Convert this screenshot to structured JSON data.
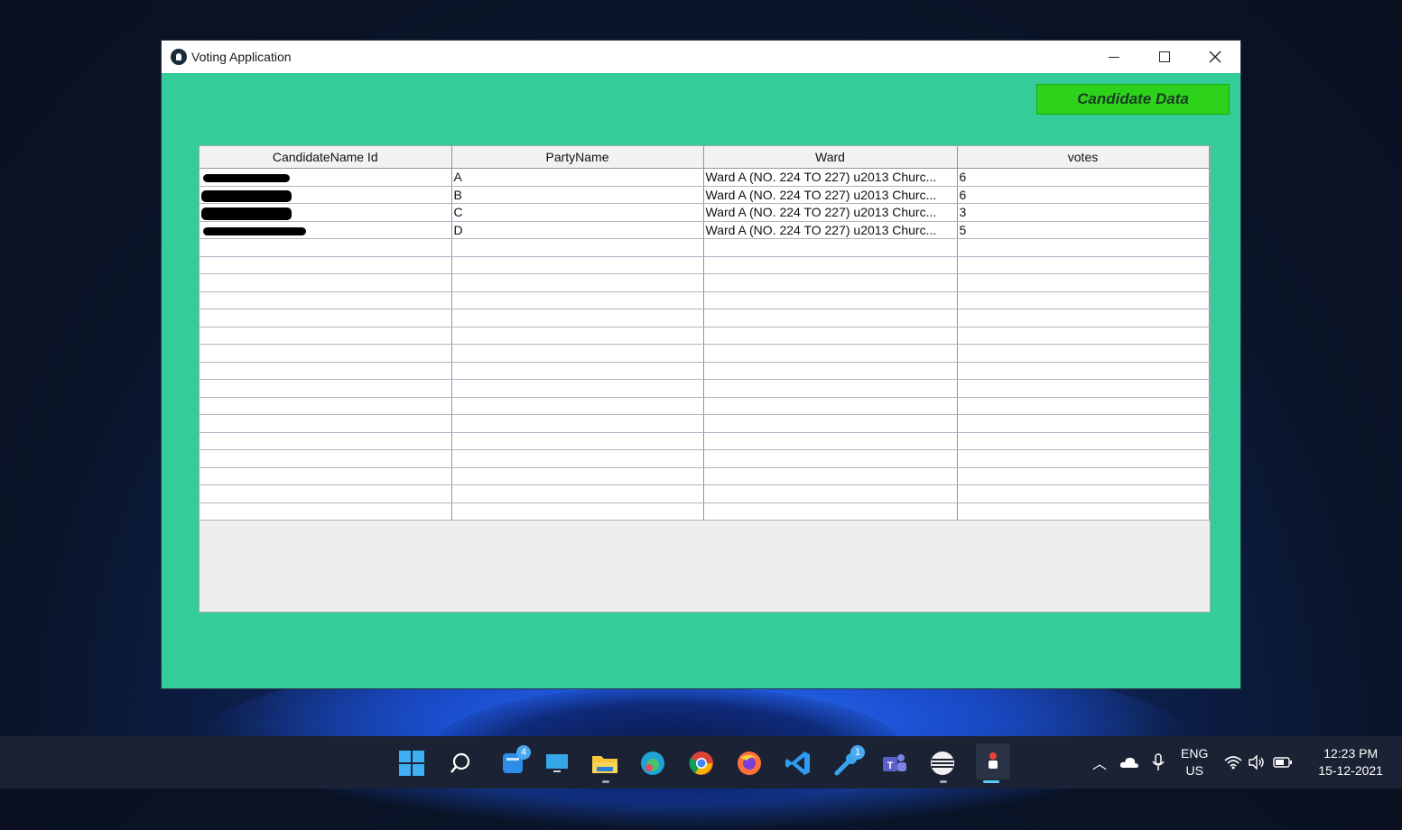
{
  "window": {
    "title": "Voting Application"
  },
  "toolbar": {
    "candidate_data_label": "Candidate Data"
  },
  "table": {
    "columns": [
      "CandidateName Id",
      "PartyName",
      "Ward",
      "votes"
    ],
    "rows": [
      {
        "party": "A",
        "ward": "Ward A (NO. 224 TO 227) u2013 Churc...",
        "votes": "6"
      },
      {
        "party": "B",
        "ward": "Ward A (NO. 224 TO 227) u2013 Churc...",
        "votes": "6"
      },
      {
        "party": "C",
        "ward": "Ward A (NO. 224 TO 227) u2013 Churc...",
        "votes": "3"
      },
      {
        "party": "D",
        "ward": "Ward A (NO. 224 TO 227) u2013 Churc...",
        "votes": "5"
      }
    ],
    "empty_rows": 16
  },
  "taskbar": {
    "apps": [
      "windows-start",
      "search",
      "widgets",
      "desktop",
      "file-explorer",
      "edge",
      "chrome",
      "firefox",
      "vscode",
      "steam",
      "teams",
      "terminal",
      "voting-app"
    ],
    "widgets_badge": "4",
    "steam_badge": "1",
    "language": "ENG",
    "region": "US",
    "time": "12:23 PM",
    "date": "15-12-2021"
  },
  "colors": {
    "window_bg": "#34cc98",
    "button_bg": "#2dd31a",
    "taskbar_bg": "#1a2233"
  }
}
